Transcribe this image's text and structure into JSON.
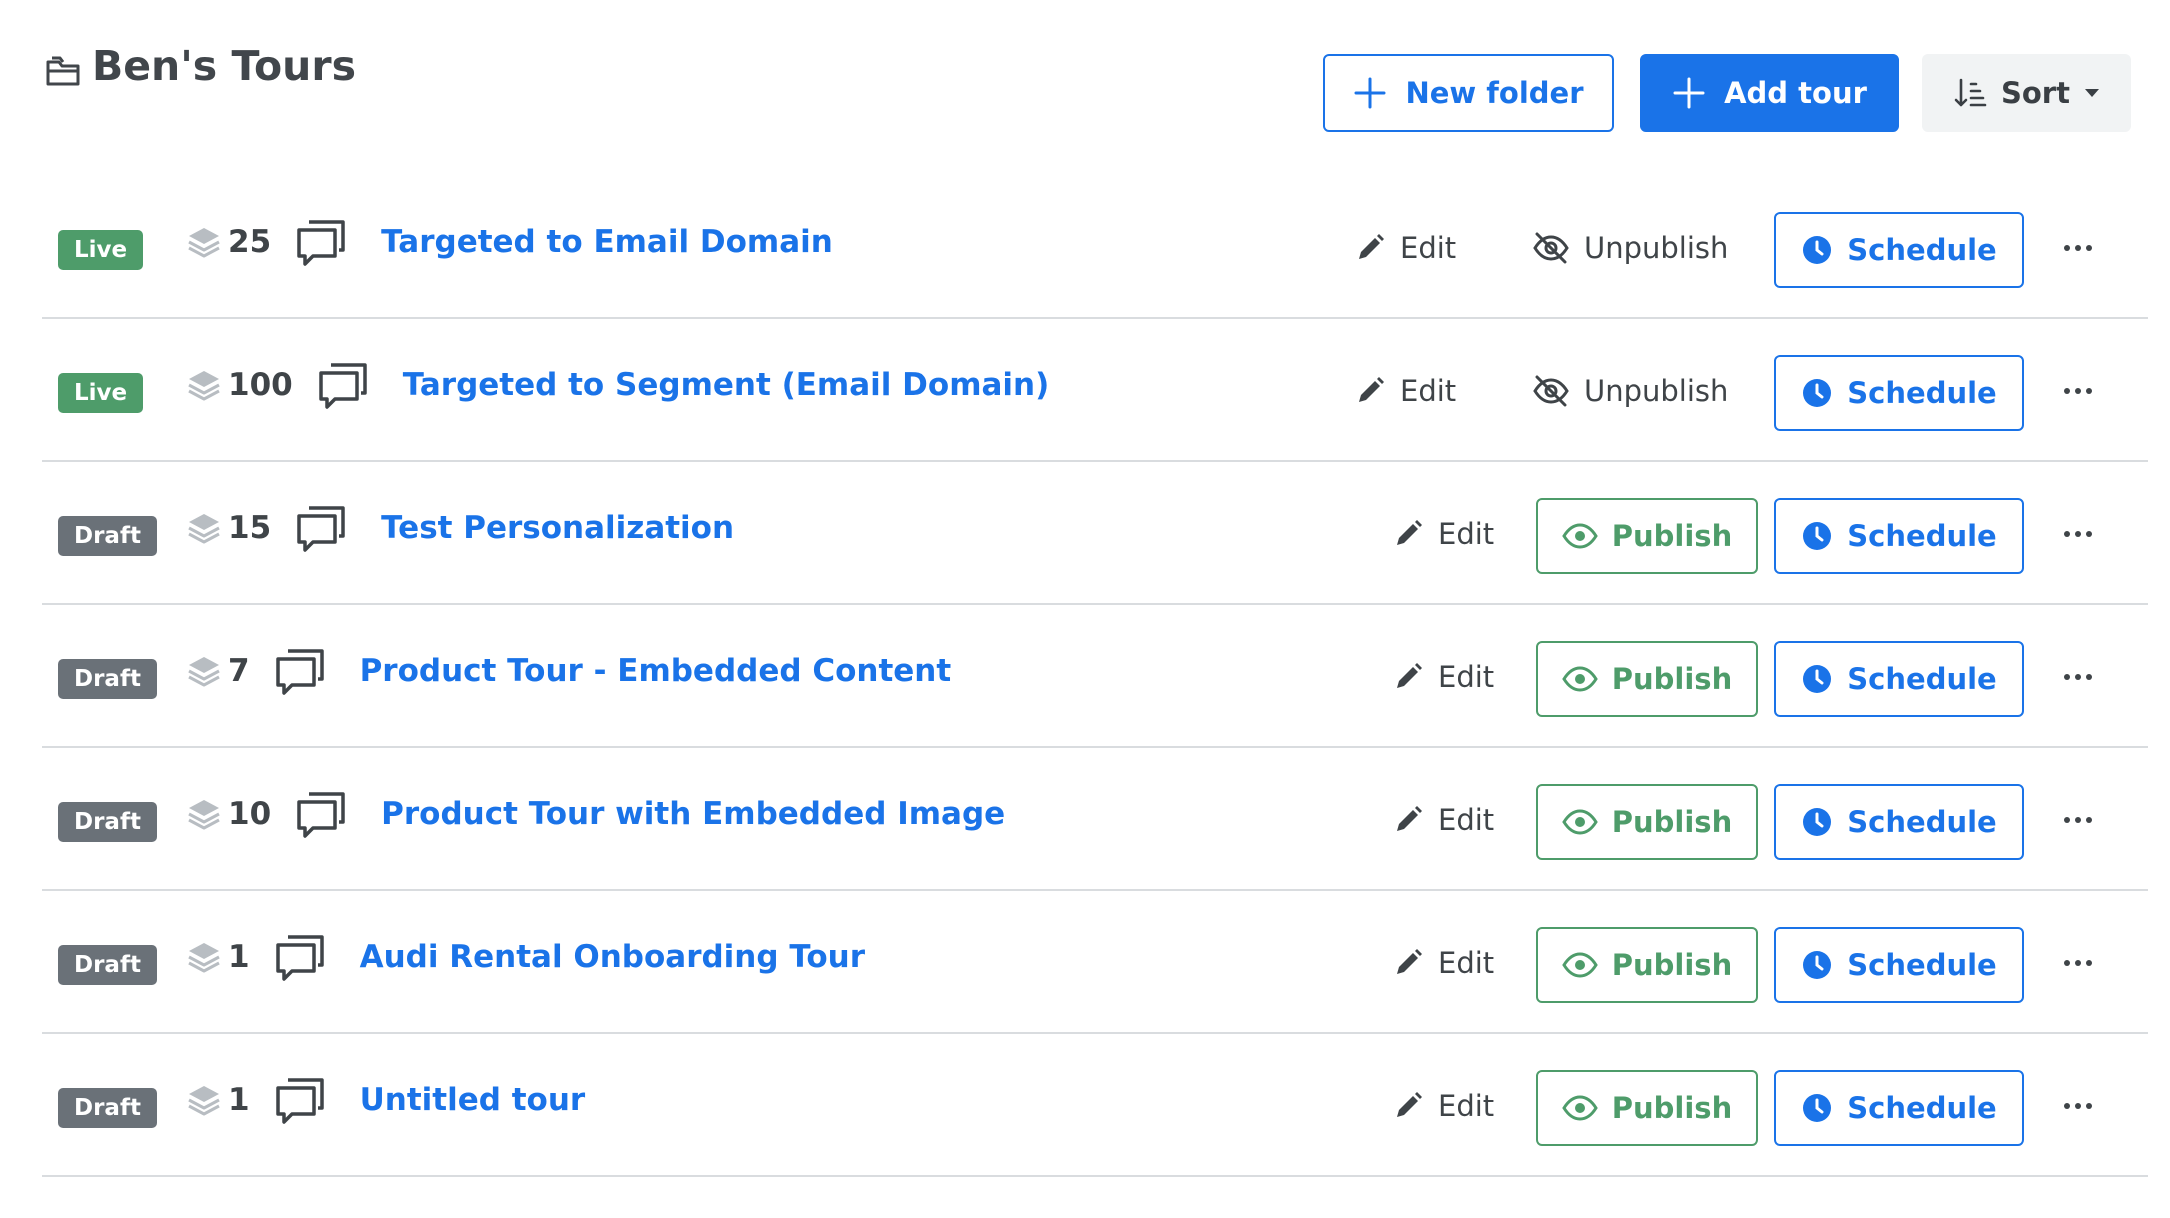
{
  "header": {
    "title": "Ben's Tours",
    "new_folder_label": "New folder",
    "add_tour_label": "Add tour",
    "sort_label": "Sort"
  },
  "actions": {
    "edit_label": "Edit",
    "unpublish_label": "Unpublish",
    "publish_label": "Publish",
    "schedule_label": "Schedule"
  },
  "colors": {
    "primary": "#1a73e8",
    "live": "#4e9c6a",
    "draft": "#6a7178"
  },
  "tours": [
    {
      "status": "Live",
      "steps": "25",
      "title": "Targeted to Email Domain"
    },
    {
      "status": "Live",
      "steps": "100",
      "title": "Targeted to Segment (Email Domain)"
    },
    {
      "status": "Draft",
      "steps": "15",
      "title": "Test Personalization"
    },
    {
      "status": "Draft",
      "steps": "7",
      "title": "Product Tour - Embedded Content"
    },
    {
      "status": "Draft",
      "steps": "10",
      "title": "Product Tour with Embedded Image"
    },
    {
      "status": "Draft",
      "steps": "1",
      "title": "Audi Rental Onboarding Tour"
    },
    {
      "status": "Draft",
      "steps": "1",
      "title": "Untitled tour"
    }
  ]
}
